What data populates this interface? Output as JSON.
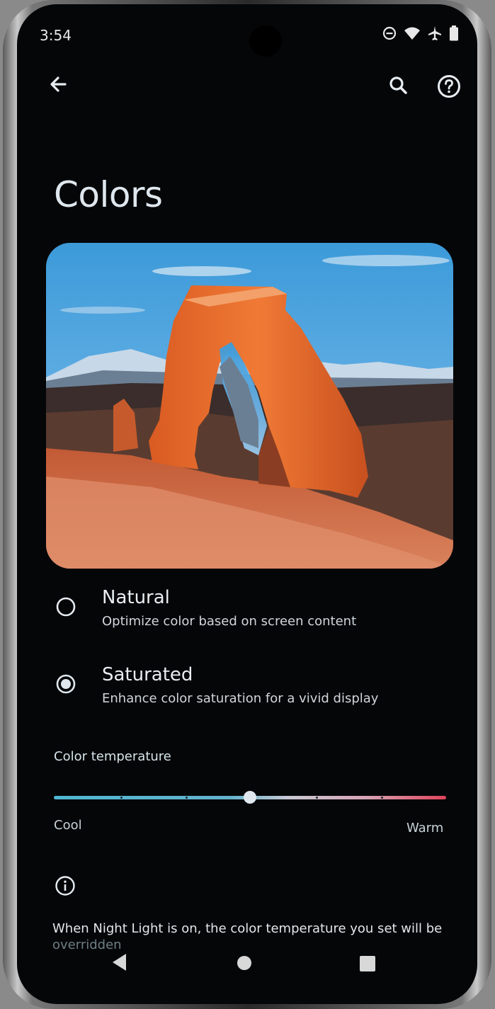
{
  "status_bar": {
    "time": "3:54",
    "icons": [
      "do-not-disturb-icon",
      "wifi-icon",
      "airplane-icon",
      "battery-icon"
    ]
  },
  "toolbar": {
    "back_icon": "arrow-back-icon",
    "search_icon": "search-icon",
    "help_icon": "help-icon"
  },
  "page": {
    "title": "Colors"
  },
  "options": [
    {
      "title": "Natural",
      "subtitle": "Optimize color based on screen content",
      "selected": false
    },
    {
      "title": "Saturated",
      "subtitle": "Enhance color saturation for a vivid display",
      "selected": true
    }
  ],
  "color_temperature": {
    "label": "Color temperature",
    "min_label": "Cool",
    "max_label": "Warm",
    "value_fraction": 0.5
  },
  "info": {
    "text_main": "When Night Light is on, the color temperature you set will be",
    "text_faded": "overridden"
  },
  "nav_bar": {
    "icons": [
      "nav-back-icon",
      "nav-home-icon",
      "nav-recents-icon"
    ]
  },
  "colors": {
    "background": "#050608",
    "text": "#dfe7ee",
    "accent": "#d6e4ea",
    "slider_cool": "#4fb7d3",
    "slider_warm": "#e0445a"
  }
}
